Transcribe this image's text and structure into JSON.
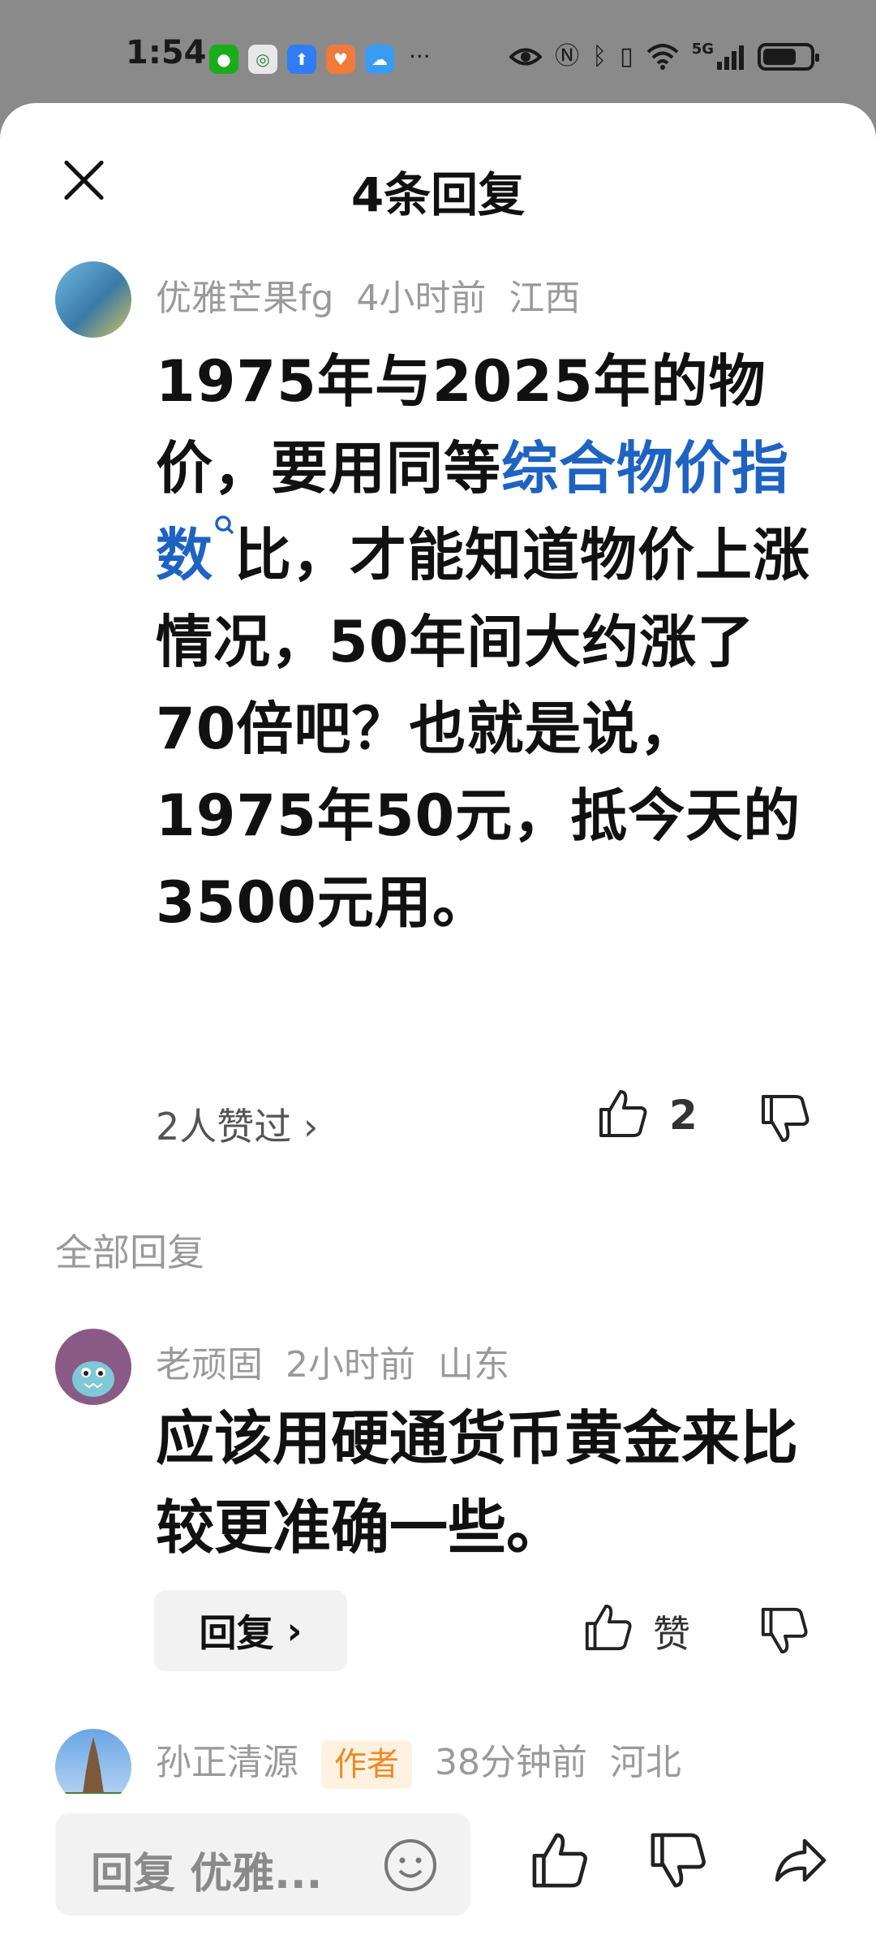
{
  "status_bar": {
    "time": "1:54",
    "app_icons": [
      "wechat-icon",
      "bank-icon",
      "upload-icon",
      "health-icon",
      "cloud-icon"
    ],
    "more": "···",
    "signal_label": "5G"
  },
  "header": {
    "title": "4条回复"
  },
  "post": {
    "author": "优雅芒果fg",
    "time": "4小时前",
    "location": "江西",
    "body_pre": "1975年与2025年的物价，要用同等",
    "body_link": "综合物价指数",
    "body_post": "比，才能知道物价上涨情况，50年间大约涨了70倍吧？也就是说，1975年50元，抵今天的3500元用。",
    "likers_label": "2人赞过",
    "likers_chevron": "›",
    "like_count": "2"
  },
  "replies_section": {
    "label": "全部回复"
  },
  "reply1": {
    "author": "老顽固",
    "time": "2小时前",
    "location": "山东",
    "text": "应该用硬通货币黄金来比较更准确一些。",
    "reply_button": "回复",
    "reply_chevron": "›",
    "like_label": "赞"
  },
  "reply2": {
    "author": "孙正清源",
    "tag": "作者",
    "time": "38分钟前",
    "location": "河北"
  },
  "bottom_bar": {
    "input_placeholder": "回复 优雅..."
  },
  "colors": {
    "link": "#1e63c2",
    "author_tag_bg": "#fff1e0",
    "author_tag_text": "#f08a24"
  }
}
